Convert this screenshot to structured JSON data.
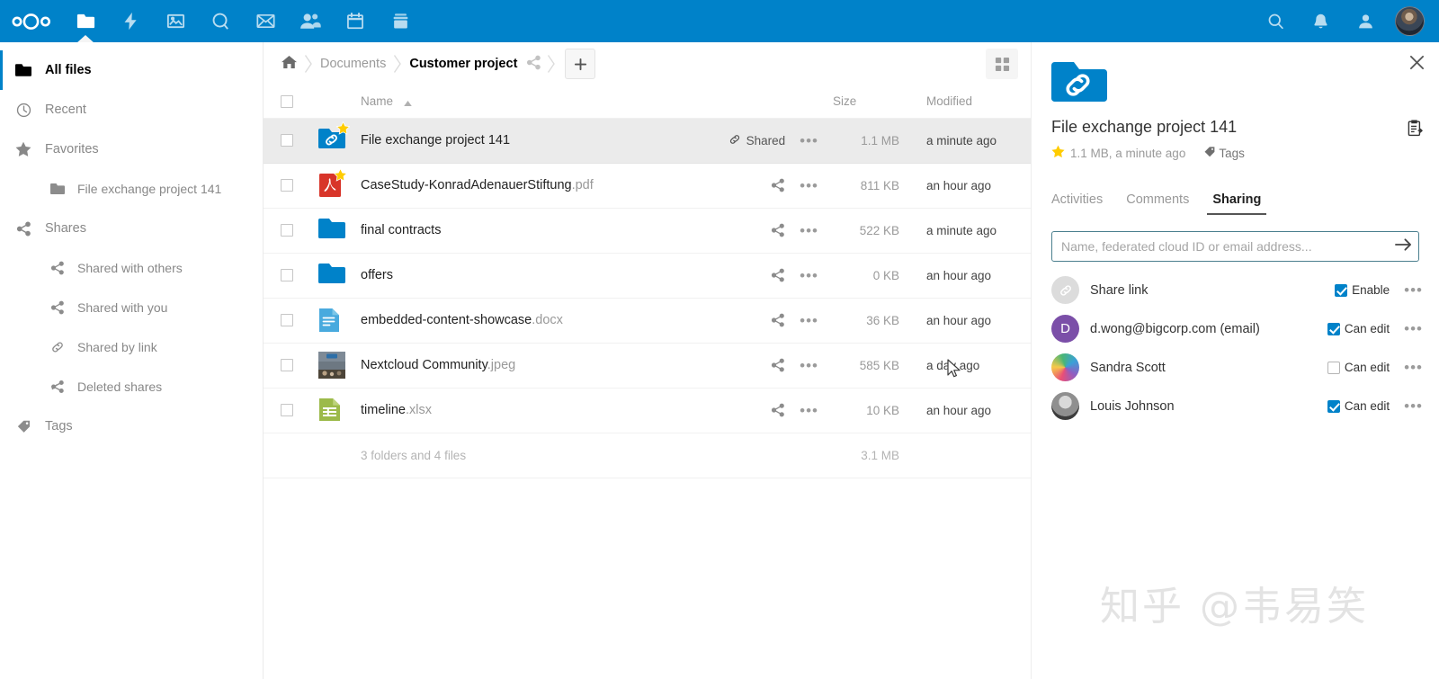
{
  "topbar": {
    "brand": "nextcloud-logo",
    "apps": [
      {
        "name": "files",
        "label": "Files",
        "active": true
      },
      {
        "name": "activity",
        "label": "Activity",
        "active": false
      },
      {
        "name": "photos",
        "label": "Photos",
        "active": false
      },
      {
        "name": "search-circle",
        "label": "Circles",
        "active": false
      },
      {
        "name": "mail",
        "label": "Mail",
        "active": false
      },
      {
        "name": "contacts",
        "label": "Contacts",
        "active": false
      },
      {
        "name": "calendar",
        "label": "Calendar",
        "active": false
      },
      {
        "name": "deck",
        "label": "Deck",
        "active": false
      }
    ],
    "right": [
      {
        "name": "search",
        "label": "Search"
      },
      {
        "name": "notifications",
        "label": "Notifications"
      },
      {
        "name": "contacts-menu",
        "label": "Contacts"
      }
    ],
    "avatar_label": "User avatar"
  },
  "sidebar": {
    "items": [
      {
        "label": "All files",
        "icon": "folder-icon",
        "active": true,
        "sub": false
      },
      {
        "label": "Recent",
        "icon": "clock-icon",
        "active": false,
        "sub": false
      },
      {
        "label": "Favorites",
        "icon": "star-icon",
        "active": false,
        "sub": false
      },
      {
        "label": "File exchange project 141",
        "icon": "folder-icon",
        "active": false,
        "sub": true
      },
      {
        "label": "Shares",
        "icon": "share-icon",
        "active": false,
        "sub": false
      },
      {
        "label": "Shared with others",
        "icon": "share-icon",
        "active": false,
        "sub": true
      },
      {
        "label": "Shared with you",
        "icon": "share-icon",
        "active": false,
        "sub": true
      },
      {
        "label": "Shared by link",
        "icon": "link-icon",
        "active": false,
        "sub": true
      },
      {
        "label": "Deleted shares",
        "icon": "share-off-icon",
        "active": false,
        "sub": true
      },
      {
        "label": "Tags",
        "icon": "tag-icon",
        "active": false,
        "sub": false
      }
    ]
  },
  "breadcrumb": {
    "home_label": "Home",
    "items": [
      {
        "label": "Documents",
        "current": false
      },
      {
        "label": "Customer project",
        "current": true
      }
    ],
    "share_label": "Share folder",
    "new_label": "+"
  },
  "filelist": {
    "headers": {
      "name": "Name",
      "size": "Size",
      "modified": "Modified",
      "sort_direction": "asc"
    },
    "rows": [
      {
        "name": "File exchange project 141",
        "ext": "",
        "icon": "folder-shared-link-icon",
        "favorite": true,
        "selected": true,
        "action_label": "Shared",
        "action_icon": "link-icon",
        "size": "1.1 MB",
        "modified": "a minute ago"
      },
      {
        "name": "CaseStudy-KonradAdenauerStiftung",
        "ext": ".pdf",
        "icon": "pdf-icon",
        "favorite": true,
        "selected": false,
        "action_label": "",
        "action_icon": "share-icon",
        "size": "811 KB",
        "modified": "an hour ago"
      },
      {
        "name": "final contracts",
        "ext": "",
        "icon": "folder-icon",
        "favorite": false,
        "selected": false,
        "action_label": "",
        "action_icon": "share-icon",
        "size": "522 KB",
        "modified": "a minute ago"
      },
      {
        "name": "offers",
        "ext": "",
        "icon": "folder-icon",
        "favorite": false,
        "selected": false,
        "action_label": "",
        "action_icon": "share-icon",
        "size": "0 KB",
        "modified": "an hour ago"
      },
      {
        "name": "embedded-content-showcase",
        "ext": ".docx",
        "icon": "document-icon",
        "favorite": false,
        "selected": false,
        "action_label": "",
        "action_icon": "share-icon",
        "size": "36 KB",
        "modified": "an hour ago"
      },
      {
        "name": "Nextcloud Community",
        "ext": ".jpeg",
        "icon": "image-thumb-icon",
        "favorite": false,
        "selected": false,
        "action_label": "",
        "action_icon": "share-icon",
        "size": "585 KB",
        "modified": "a day ago"
      },
      {
        "name": "timeline",
        "ext": ".xlsx",
        "icon": "spreadsheet-icon",
        "favorite": false,
        "selected": false,
        "action_label": "",
        "action_icon": "share-icon",
        "size": "10 KB",
        "modified": "an hour ago"
      }
    ],
    "summary_text": "3 folders and 4 files",
    "summary_size": "3.1 MB",
    "menu_dots": "•••"
  },
  "detail": {
    "title": "File exchange project 141",
    "meta": "1.1 MB, a minute ago",
    "tags_label": "Tags",
    "favorite": true,
    "tabs": [
      {
        "label": "Activities",
        "active": false
      },
      {
        "label": "Comments",
        "active": false
      },
      {
        "label": "Sharing",
        "active": true
      }
    ],
    "share_input": {
      "value": "",
      "placeholder": "Name, federated cloud ID or email address..."
    },
    "shares": [
      {
        "name": "Share link",
        "avatar": "link",
        "avatar_letter": "",
        "perm_label": "Enable",
        "perm_checked": true
      },
      {
        "name": "d.wong@bigcorp.com (email)",
        "avatar": "letter",
        "avatar_letter": "D",
        "perm_label": "Can edit",
        "perm_checked": true
      },
      {
        "name": "Sandra Scott",
        "avatar": "photo-colorful",
        "avatar_letter": "",
        "perm_label": "Can edit",
        "perm_checked": false
      },
      {
        "name": "Louis Johnson",
        "avatar": "photo-gray",
        "avatar_letter": "",
        "perm_label": "Can edit",
        "perm_checked": true
      }
    ],
    "menu_dots": "•••"
  },
  "watermark": "知乎 @韦易笑",
  "colors": {
    "brand": "#0082c9",
    "folder": "#0082c9",
    "pdf": "#d8352a",
    "doc": "#49aade",
    "xls": "#9cba4a",
    "selected_row": "#ebebeb",
    "star": "#fc0"
  }
}
